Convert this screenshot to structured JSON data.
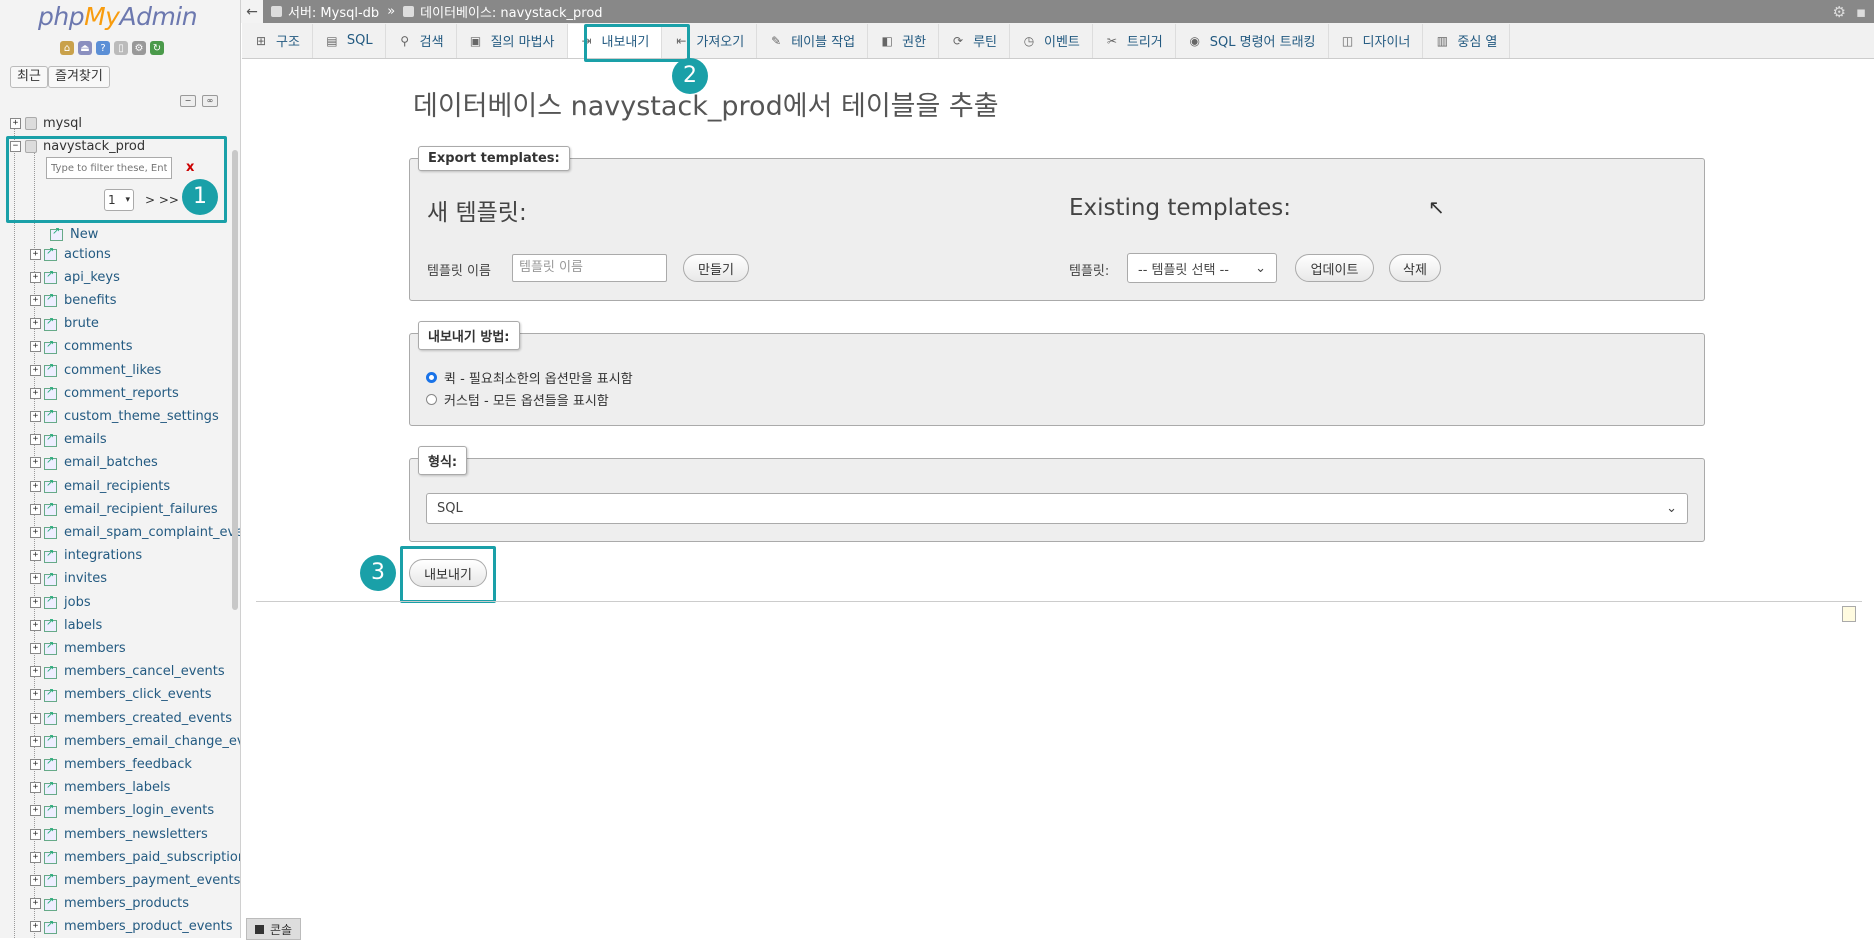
{
  "sidebar": {
    "logo": {
      "php": "php",
      "my": "My",
      "admin": "Admin"
    },
    "recent_button": "최근",
    "favorites_button": "즐겨찾기",
    "databases": [
      {
        "name": "mysql",
        "expander": "+"
      },
      {
        "name": "navystack_prod",
        "expander": "−"
      }
    ],
    "filter_placeholder": "Type to filter these, Enter",
    "filter_clear": "x",
    "page_value": "1",
    "page_next": "> >>",
    "new_label": "New",
    "tables": [
      "actions",
      "api_keys",
      "benefits",
      "brute",
      "comments",
      "comment_likes",
      "comment_reports",
      "custom_theme_settings",
      "emails",
      "email_batches",
      "email_recipients",
      "email_recipient_failures",
      "email_spam_complaint_events",
      "integrations",
      "invites",
      "jobs",
      "labels",
      "members",
      "members_cancel_events",
      "members_click_events",
      "members_created_events",
      "members_email_change_events",
      "members_feedback",
      "members_labels",
      "members_login_events",
      "members_newsletters",
      "members_paid_subscription_events",
      "members_payment_events",
      "members_products",
      "members_product_events"
    ]
  },
  "topbar": {
    "back": "←",
    "server_crumb": "서버: Mysql-db",
    "separator": "»",
    "db_crumb": "데이터베이스: navystack_prod"
  },
  "tabs": [
    {
      "label": "구조",
      "icon": "structure-icon",
      "glyph": "⊞"
    },
    {
      "label": "SQL",
      "icon": "sql-icon",
      "glyph": "▤"
    },
    {
      "label": "검색",
      "icon": "search-icon",
      "glyph": "⚲"
    },
    {
      "label": "질의 마법사",
      "icon": "query-icon",
      "glyph": "▣"
    },
    {
      "label": "내보내기",
      "icon": "export-icon",
      "glyph": "⇥"
    },
    {
      "label": "가져오기",
      "icon": "import-icon",
      "glyph": "⇤"
    },
    {
      "label": "테이블 작업",
      "icon": "wrench-icon",
      "glyph": "✎"
    },
    {
      "label": "권한",
      "icon": "privileges-icon",
      "glyph": "◧"
    },
    {
      "label": "루틴",
      "icon": "routines-icon",
      "glyph": "⟳"
    },
    {
      "label": "이벤트",
      "icon": "events-icon",
      "glyph": "◷"
    },
    {
      "label": "트리거",
      "icon": "triggers-icon",
      "glyph": "✂"
    },
    {
      "label": "SQL 명령어 트래킹",
      "icon": "eye-icon",
      "glyph": "◉"
    },
    {
      "label": "디자이너",
      "icon": "designer-icon",
      "glyph": "◫"
    },
    {
      "label": "중심 열",
      "icon": "central-columns-icon",
      "glyph": "▥"
    }
  ],
  "main": {
    "title": "데이터베이스 navystack_prod에서 테이블을 추출",
    "templates": {
      "legend": "Export templates:",
      "new_heading": "새 템플릿:",
      "existing_heading": "Existing templates:",
      "name_label": "템플릿 이름",
      "name_placeholder": "템플릿 이름",
      "create_button": "만들기",
      "template_label": "템플릿:",
      "template_select": "-- 템플릿 선택 --",
      "update_button": "업데이트",
      "delete_button": "삭제"
    },
    "method": {
      "legend": "내보내기 방법:",
      "quick": "퀵 - 필요최소한의 옵션만을 표시함",
      "custom": "커스텀 - 모든 옵션들을 표시함"
    },
    "format": {
      "legend": "형식:",
      "value": "SQL"
    },
    "export_button": "내보내기"
  },
  "annotations": {
    "badge1": "1",
    "badge2": "2",
    "badge3": "3",
    "highlight_color": "#1aa0a8"
  },
  "console": {
    "label": "콘솔"
  }
}
